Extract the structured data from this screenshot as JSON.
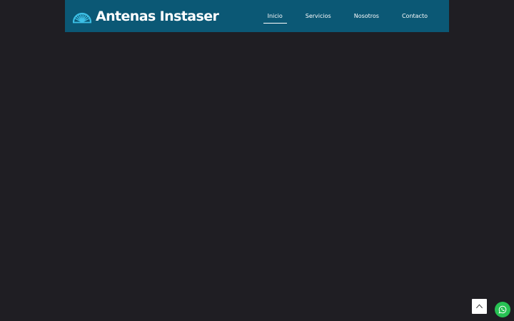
{
  "header": {
    "brand_name": "Antenas Instaser",
    "logo_icon": "sunburst-dish-logo-icon",
    "background_color": "#0b5875",
    "nav": [
      {
        "label": "Inicio",
        "active": true
      },
      {
        "label": "Servicios",
        "active": false
      },
      {
        "label": "Nosotros",
        "active": false
      },
      {
        "label": "Contacto",
        "active": false
      }
    ]
  },
  "page": {
    "background_color": "#1f1e23"
  },
  "floating": {
    "back_to_top_icon": "chevron-up-icon",
    "whatsapp_icon": "whatsapp-icon",
    "whatsapp_color": "#27c253"
  }
}
